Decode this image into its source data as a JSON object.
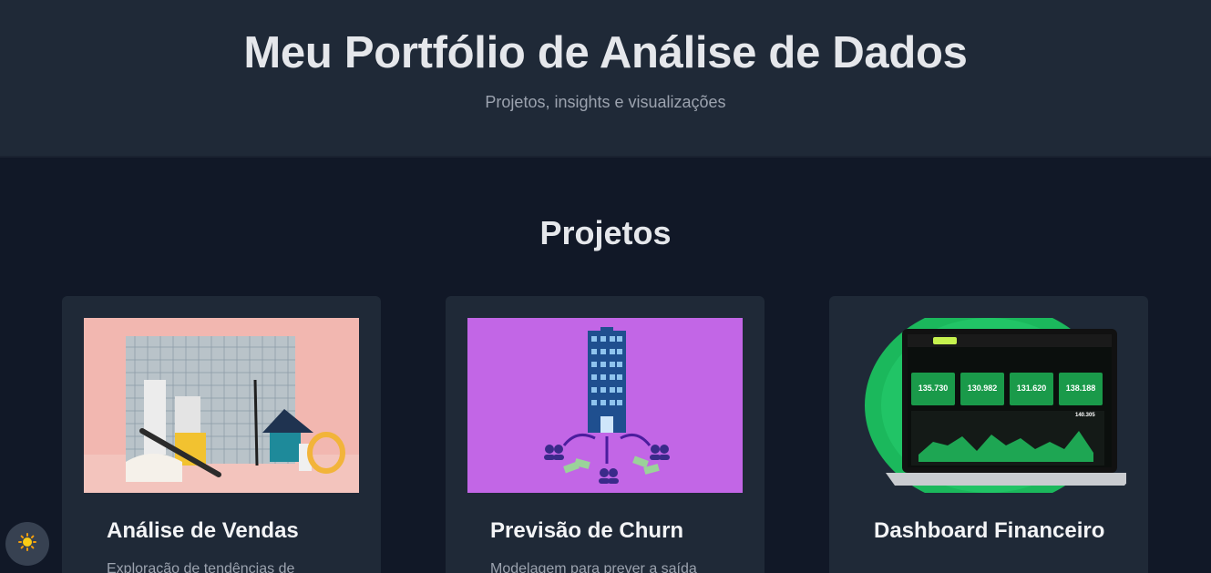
{
  "header": {
    "title": "Meu Portfólio de Análise de Dados",
    "subtitle": "Projetos, insights e visualizações"
  },
  "projects": {
    "title": "Projetos",
    "items": [
      {
        "title": "Análise de Vendas",
        "description": "Exploração de tendências de",
        "image": "sales-analysis-image"
      },
      {
        "title": "Previsão de Churn",
        "description": "Modelagem para prever a saída",
        "image": "churn-prediction-image"
      },
      {
        "title": "Dashboard Financeiro",
        "description": "",
        "image": "financial-dashboard-image"
      }
    ]
  },
  "dashboard_preview": {
    "kpis": [
      "135.730",
      "130.982",
      "131.620",
      "138.188"
    ],
    "chart_value": "140.305"
  },
  "theme_toggle": {
    "icon": "sun-icon",
    "color": "#facc15"
  },
  "colors": {
    "page_bg": "#111827",
    "header_bg": "#1f2937",
    "card_bg": "#1f2937",
    "accent_green": "#22c55e",
    "purple": "#c266e6"
  }
}
